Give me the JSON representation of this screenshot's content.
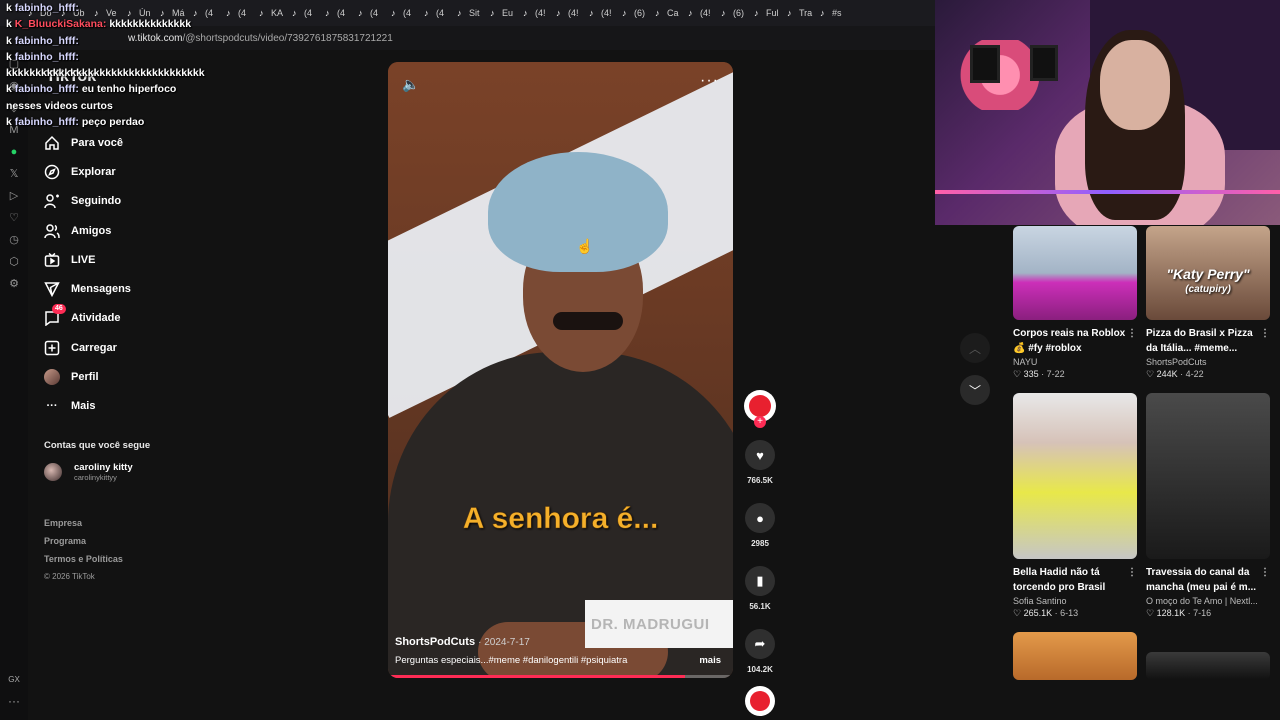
{
  "browser": {
    "tabs": [
      "Dó",
      "Ub",
      "Ve",
      "Ún",
      "Má",
      "(4",
      "(4",
      "KA",
      "(4",
      "(4",
      "(4",
      "(4",
      "(4",
      "Sit",
      "Eu",
      "(4!",
      "(4!",
      "(4!",
      "(6)",
      "Ca",
      "(4!",
      "(6)",
      "Ful",
      "Tra",
      "#s"
    ],
    "url_host": "w.tiktok.com",
    "url_path": "/@shortspodcuts/video/7392761875831721221"
  },
  "chat": [
    {
      "user": "fabinho_hfff:",
      "text": "",
      "red": false
    },
    {
      "user": "K_BluuckiSakana:",
      "text": "kkkkkkkkkkkkkk",
      "red": true
    },
    {
      "user": "fabinho_hfff:",
      "text": "",
      "red": false
    },
    {
      "user": "fabinho_hfff:",
      "text": "",
      "red": false
    },
    {
      "user": "",
      "text": "kkkkkkkkkkkkkkkkkkkkkkkkkkkkkkkkkk",
      "red": false
    },
    {
      "user": "fabinho_hfff:",
      "text": "eu tenho hiperfoco",
      "red": false
    },
    {
      "user": "",
      "text": "nesses videos curtos",
      "red": false
    },
    {
      "user": "fabinho_hfff:",
      "text": "peço perdao",
      "red": false
    }
  ],
  "logo": "TikTok",
  "nav": [
    {
      "label": "Para você",
      "icon": "home-icon"
    },
    {
      "label": "Explorar",
      "icon": "compass-icon"
    },
    {
      "label": "Seguindo",
      "icon": "following-icon"
    },
    {
      "label": "Amigos",
      "icon": "friends-icon"
    },
    {
      "label": "LIVE",
      "icon": "live-icon"
    },
    {
      "label": "Mensagens",
      "icon": "messages-icon"
    },
    {
      "label": "Atividade",
      "icon": "activity-icon",
      "badge": "46"
    },
    {
      "label": "Carregar",
      "icon": "upload-icon"
    },
    {
      "label": "Perfil",
      "icon": "profile-avatar"
    },
    {
      "label": "Mais",
      "icon": "more-dots-icon"
    }
  ],
  "following": {
    "title": "Contas que você segue",
    "account_name": "caroliny kitty",
    "account_handle": "carolinykittyy"
  },
  "footer": {
    "links": [
      "Empresa",
      "Programa",
      "Termos e Políticas"
    ],
    "copyright": "© 2026 TikTok"
  },
  "video": {
    "caption_overlay": "A senhora é...",
    "nameplate": "DR. MADRUGUI",
    "author": "ShortsPodCuts",
    "date": "· 2024-7-17",
    "description": "Perguntas especiais...#meme #danilogentili #psiquiatra",
    "more_label": "mais",
    "progress": 0.86
  },
  "actions": {
    "likes": "766.5K",
    "comments": "2985",
    "saves": "56.1K",
    "shares": "104.2K"
  },
  "recommendations": [
    {
      "title": "Corpos reais na Roblox 💰 #fy #roblox",
      "author": "NAYU",
      "likes": "335",
      "date": "· 7-22",
      "overlay": "",
      "overlay2": ""
    },
    {
      "title": "Pizza do Brasil x Pizza da Itália... #meme...",
      "author": "ShortsPodCuts",
      "likes": "244K",
      "date": "· 4-22",
      "overlay": "\"Katy Perry\"",
      "overlay2": "(catupiry)"
    },
    {
      "title": "Bella Hadid não tá torcendo pro Brasil BR...",
      "author": "Sofia Santino",
      "likes": "265.1K",
      "date": "· 6-13",
      "overlay": "",
      "overlay2": ""
    },
    {
      "title": "Travessia do canal da mancha (meu pai é m...",
      "author": "O moço do Te Amo | Nextl...",
      "likes": "128.1K",
      "date": "· 7-16",
      "overlay": "",
      "overlay2": ""
    }
  ],
  "rail_bottom": "GX"
}
